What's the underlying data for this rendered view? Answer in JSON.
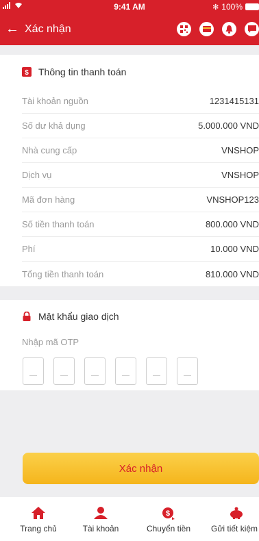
{
  "status_bar": {
    "time": "9:41 AM",
    "battery": "100%"
  },
  "header": {
    "title": "Xác nhận"
  },
  "payment_info": {
    "title": "Thông tin thanh toán",
    "rows": [
      {
        "label": "Tài khoản nguồn",
        "value": "1231415131"
      },
      {
        "label": "Số dư khả dụng",
        "value": "5.000.000 VND"
      },
      {
        "label": "Nhà cung cấp",
        "value": "VNSHOP"
      },
      {
        "label": "Dịch vụ",
        "value": "VNSHOP"
      },
      {
        "label": "Mã đơn hàng",
        "value": "VNSHOP123"
      },
      {
        "label": "Số tiền thanh toán",
        "value": "800.000 VND"
      },
      {
        "label": "Phí",
        "value": "10.000 VND"
      },
      {
        "label": "Tổng tiền thanh toán",
        "value": "810.000 VND"
      }
    ]
  },
  "transaction_password": {
    "title": "Mật khẩu giao dịch",
    "otp_label": "Nhập mã OTP",
    "otp_digits": [
      "",
      "",
      "",
      "",
      "",
      ""
    ]
  },
  "confirm_button": {
    "label": "Xác nhận"
  },
  "tab_bar": {
    "items": [
      {
        "label": "Trang chủ",
        "icon": "home-icon"
      },
      {
        "label": "Tài khoản",
        "icon": "user-icon"
      },
      {
        "label": "Chuyển tiền",
        "icon": "money-transfer-icon"
      },
      {
        "label": "Gửi tiết kiệm",
        "icon": "piggy-bank-icon"
      }
    ]
  },
  "colors": {
    "brand_red": "#d7202a",
    "button_yellow": "#f8c232",
    "background": "#eeeef0"
  }
}
